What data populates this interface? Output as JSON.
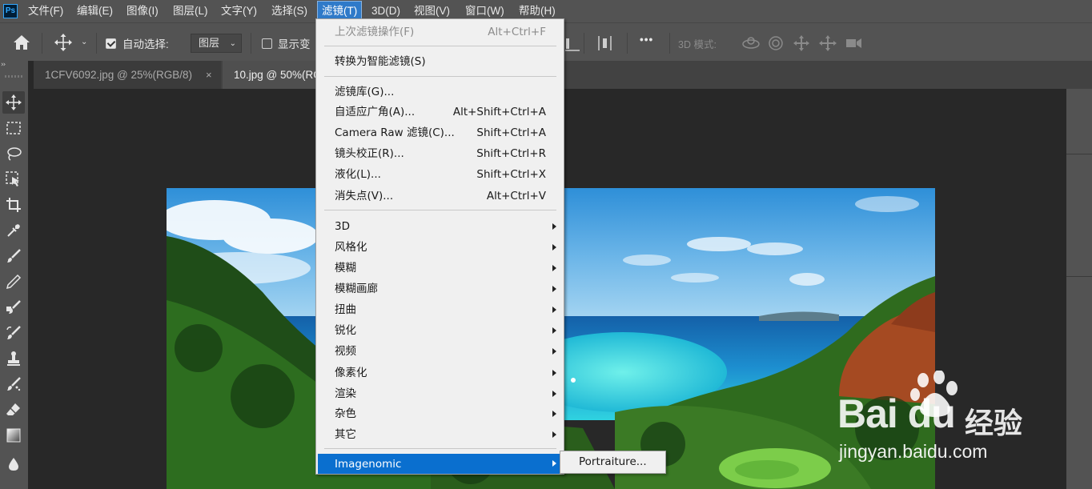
{
  "app": {
    "logo": "Ps"
  },
  "menubar": {
    "items": [
      "文件(F)",
      "编辑(E)",
      "图像(I)",
      "图层(L)",
      "文字(Y)",
      "选择(S)",
      "滤镜(T)",
      "3D(D)",
      "视图(V)",
      "窗口(W)",
      "帮助(H)"
    ],
    "active_index": 6
  },
  "options_bar": {
    "auto_select_label": "自动选择:",
    "auto_select_checked": true,
    "layer_dropdown_value": "图层",
    "show_transform_label": "显示变",
    "show_transform_checked": false,
    "more_label": "•••",
    "mode_3d_label": "3D 模式:"
  },
  "tabs": [
    {
      "title": "1CFV6092.jpg @ 25%(RGB/8)",
      "close": "×",
      "active": false
    },
    {
      "title": "10.jpg @ 50%(RGB/8)",
      "active": true
    }
  ],
  "filter_menu": {
    "items": [
      {
        "label": "上次滤镜操作(F)",
        "shortcut": "Alt+Ctrl+F",
        "disabled": true
      },
      {
        "label": "转换为智能滤镜(S)"
      },
      {
        "label": "滤镜库(G)..."
      },
      {
        "label": "自适应广角(A)...",
        "shortcut": "Alt+Shift+Ctrl+A"
      },
      {
        "label": "Camera Raw 滤镜(C)...",
        "shortcut": "Shift+Ctrl+A"
      },
      {
        "label": "镜头校正(R)...",
        "shortcut": "Shift+Ctrl+R"
      },
      {
        "label": "液化(L)...",
        "shortcut": "Shift+Ctrl+X"
      },
      {
        "label": "消失点(V)...",
        "shortcut": "Alt+Ctrl+V"
      },
      {
        "label": "3D",
        "submenu": true
      },
      {
        "label": "风格化",
        "submenu": true
      },
      {
        "label": "模糊",
        "submenu": true
      },
      {
        "label": "模糊画廊",
        "submenu": true
      },
      {
        "label": "扭曲",
        "submenu": true
      },
      {
        "label": "锐化",
        "submenu": true
      },
      {
        "label": "视频",
        "submenu": true
      },
      {
        "label": "像素化",
        "submenu": true
      },
      {
        "label": "渲染",
        "submenu": true
      },
      {
        "label": "杂色",
        "submenu": true
      },
      {
        "label": "其它",
        "submenu": true
      },
      {
        "label": "Imagenomic",
        "submenu": true,
        "highlighted": true
      }
    ],
    "submenu_items": [
      "Portraiture..."
    ]
  },
  "watermark": {
    "logo_text": "Bai du",
    "brand_cn": "经验",
    "url": "jingyan.baidu.com"
  },
  "colors": {
    "menu_highlight": "#0a6fcf",
    "ui_panel": "#535353",
    "workspace": "#282828"
  },
  "icons": [
    "home-icon",
    "move-tool-icon",
    "marquee-icon",
    "lasso-icon",
    "object-select-icon",
    "crop-icon",
    "eyedropper-icon",
    "brush-icon",
    "pencil-icon",
    "clone-brush-icon",
    "history-brush-icon",
    "stamp-icon",
    "heal-brush-icon",
    "eraser-icon",
    "gradient-icon",
    "blur-drop-icon"
  ]
}
